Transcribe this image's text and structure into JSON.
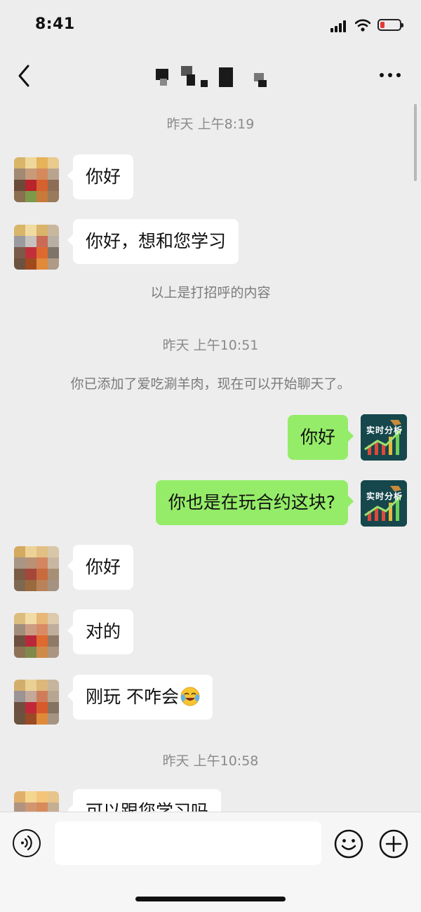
{
  "status_bar": {
    "time": "8:41"
  },
  "nav": {
    "title": ""
  },
  "messages": {
    "ts1": "昨天 上午8:19",
    "m1": "你好",
    "m2": "你好，想和您学习",
    "sys1": "以上是打招呼的内容",
    "ts2": "昨天 上午10:51",
    "sys2": "你已添加了爱吃涮羊肉，现在可以开始聊天了。",
    "m3": "你好",
    "m4": "你也是在玩合约这块?",
    "m5": "你好",
    "m6": "对的",
    "m7": "刚玩 不咋会",
    "ts3": "昨天 上午10:58",
    "m8": "可以跟您学习吗"
  },
  "my_avatar_text": "实时分析",
  "colors": {
    "outgoing_bubble": "#95ec69",
    "incoming_bubble": "#ffffff",
    "background": "#ededed"
  },
  "icons": [
    "back-chevron-icon",
    "more-dots-icon",
    "voice-icon",
    "emoji-icon",
    "plus-icon",
    "crying-laughing-emoji"
  ]
}
